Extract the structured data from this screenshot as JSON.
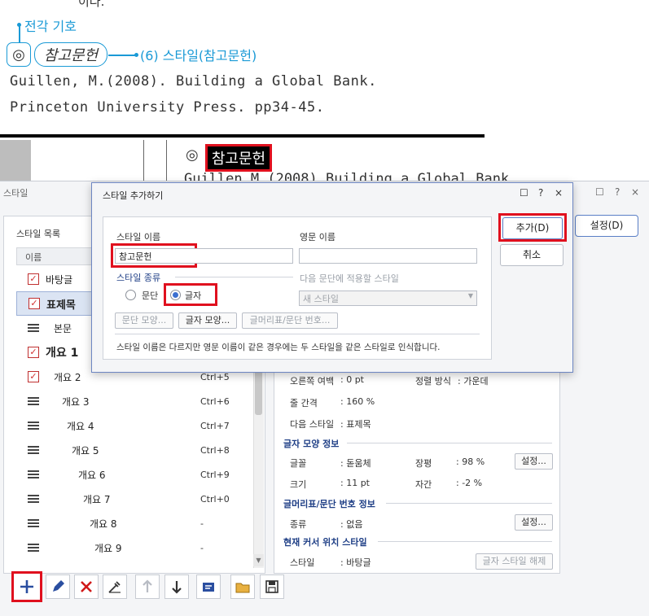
{
  "document": {
    "cut_text": "이다.",
    "annotation_symbol": "전각 기호",
    "symbol_char": "◎",
    "ref_heading": "참고문헌",
    "annotation_style": "(6) 스타일(참고문헌)",
    "ref_line1": "Guillen,  M.(2008).  Building  a  Global  Bank.",
    "ref_line2": "Princeton  University  Press.  pp34-45.",
    "strip_symbol": "◎",
    "strip_heading": "참고문헌",
    "strip_text": "Guillen   M (2008)   Building   a   Global   Bank"
  },
  "style_window": {
    "title": "스타일",
    "controls": [
      "☐",
      "?",
      "×"
    ],
    "list_label": "스타일 목록",
    "list_header": "이름",
    "settings_button": "설정(D)",
    "items": [
      {
        "name": "바탕글",
        "shortcut": "",
        "icon": "check-icon"
      },
      {
        "name": "표제목",
        "shortcut": "",
        "icon": "check-icon"
      },
      {
        "name": "본문",
        "shortcut": "",
        "icon": "lines-icon"
      },
      {
        "name": "개요 1",
        "shortcut": "",
        "icon": "check-icon"
      },
      {
        "name": "개요 2",
        "shortcut": "Ctrl+5",
        "icon": "check-icon"
      },
      {
        "name": "개요 3",
        "shortcut": "Ctrl+6",
        "icon": "lines-icon"
      },
      {
        "name": "개요 4",
        "shortcut": "Ctrl+7",
        "icon": "lines-icon"
      },
      {
        "name": "개요 5",
        "shortcut": "Ctrl+8",
        "icon": "lines-icon"
      },
      {
        "name": "개요 6",
        "shortcut": "Ctrl+9",
        "icon": "lines-icon"
      },
      {
        "name": "개요 7",
        "shortcut": "Ctrl+0",
        "icon": "lines-icon"
      },
      {
        "name": "개요 8",
        "shortcut": "-",
        "icon": "lines-icon"
      },
      {
        "name": "개요 9",
        "shortcut": "-",
        "icon": "lines-icon"
      }
    ],
    "para_info": {
      "right_margin_label": "오른쪽 여백",
      "right_margin_value": ": 0 pt",
      "align_label": "정렬 방식",
      "align_value": ": 가운데",
      "line_spacing_label": "줄 간격",
      "line_spacing_value": ": 160 %",
      "next_style_label": "다음 스타일",
      "next_style_value": ": 표제목"
    },
    "char_info": {
      "heading": "글자 모양 정보",
      "font_label": "글꼴",
      "font_value": ": 돋움체",
      "width_label": "장평",
      "width_value": ": 98 %",
      "size_label": "크기",
      "size_value": ": 11 pt",
      "spacing_label": "자간",
      "spacing_value": ": -2 %",
      "settings": "설정..."
    },
    "numbering_info": {
      "heading": "글머리표/문단 번호 정보",
      "kind_label": "종류",
      "kind_value": ": 없음",
      "settings": "설정..."
    },
    "cursor_info": {
      "heading": "현재 커서 위치 스타일",
      "style_label": "스타일",
      "style_value": ": 바탕글",
      "release_button": "글자 스타일 해제"
    },
    "toolbar": [
      "add-icon",
      "edit-icon",
      "delete-icon",
      "eyedropper-icon",
      "move-up-icon",
      "move-down-icon",
      "import-icon",
      "open-folder-icon",
      "save-icon"
    ]
  },
  "dialog": {
    "title": "스타일 추가하기",
    "controls": [
      "☐",
      "?",
      "×"
    ],
    "style_name_label": "스타일 이름",
    "style_name_value": "참고문헌",
    "english_name_label": "영문 이름",
    "english_name_value": "",
    "style_kind_label": "스타일 종류",
    "kind_paragraph": "문단",
    "kind_character": "글자",
    "next_style_label": "다음 문단에 적용할 스타일",
    "next_style_value": "새 스타일",
    "para_shape_button": "문단 모양...",
    "char_shape_button": "글자 모양...",
    "numbering_button": "글머리표/문단 번호...",
    "note": "스타일 이름은 다르지만 영문 이름이 같은 경우에는 두 스타일을 같은 스타일로 인식합니다.",
    "add_button": "추가(D)",
    "cancel_button": "취소"
  }
}
